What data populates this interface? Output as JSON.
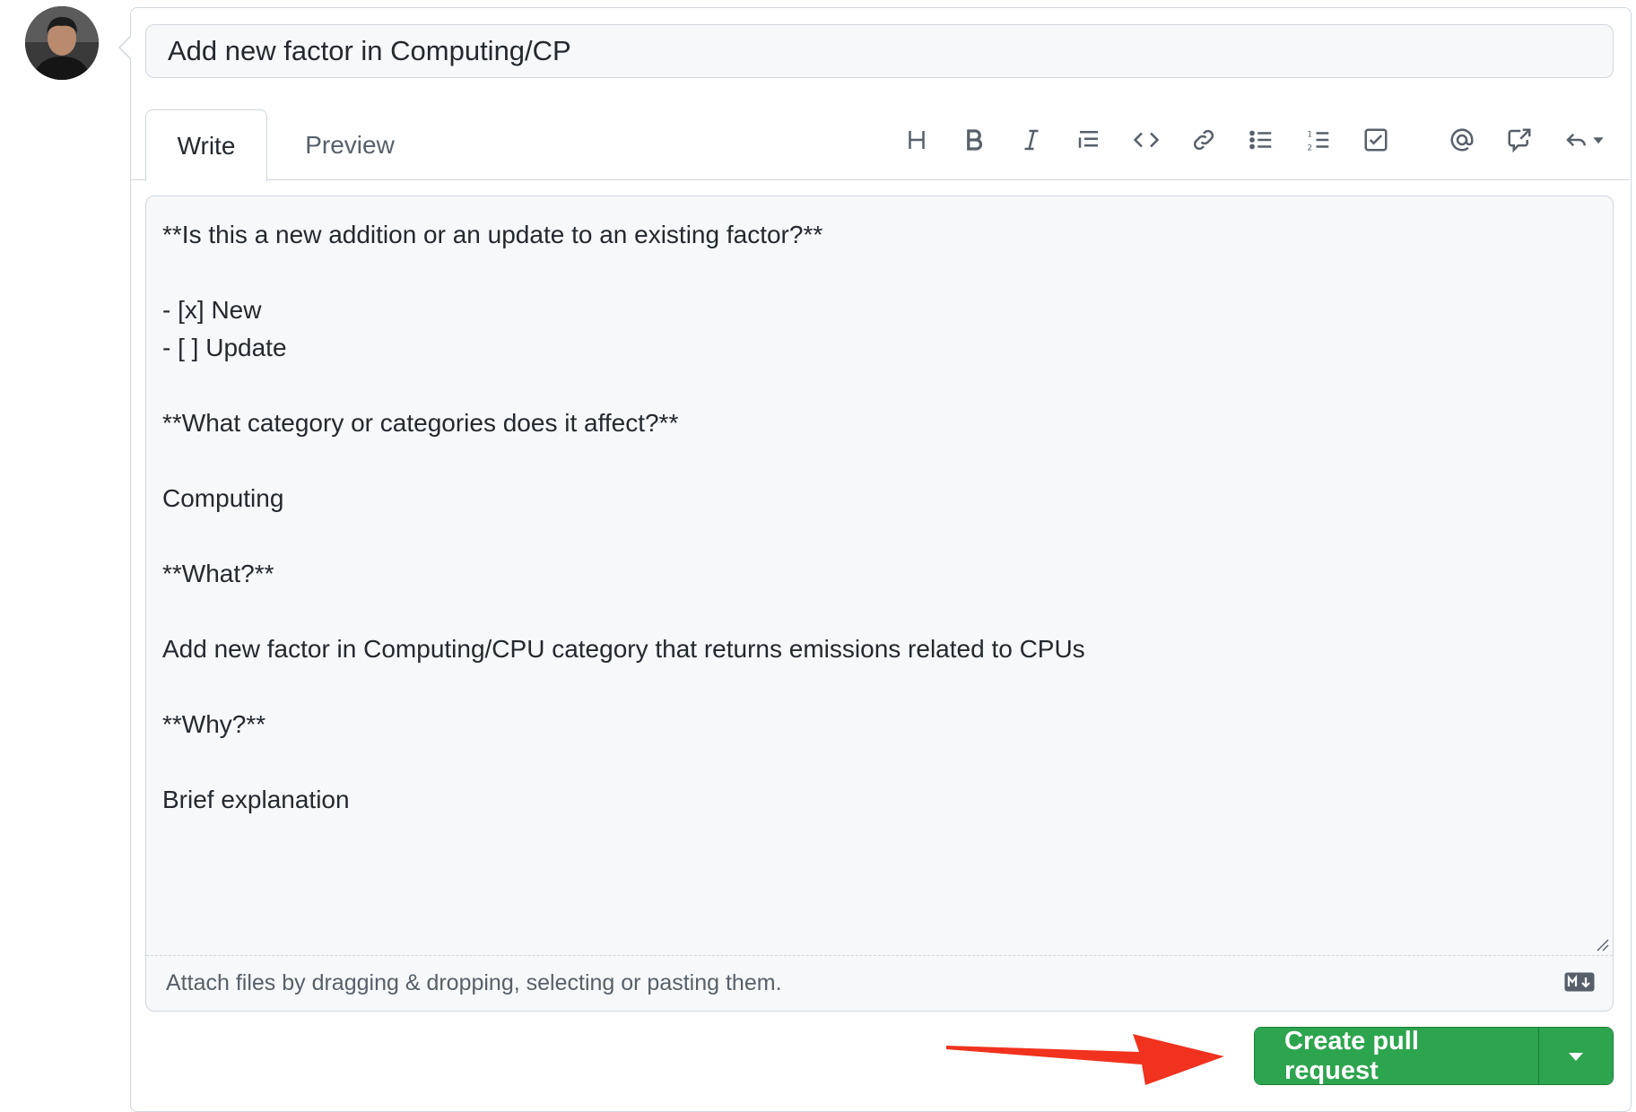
{
  "title_input": {
    "value": "Add new factor in Computing/CP"
  },
  "tabs": [
    {
      "label": "Write",
      "active": true
    },
    {
      "label": "Preview",
      "active": false
    }
  ],
  "toolbar": {
    "icons": [
      "heading-icon",
      "bold-icon",
      "italic-icon",
      "quote-icon",
      "code-icon",
      "link-icon",
      "unordered-list-icon",
      "ordered-list-icon",
      "task-list-icon",
      "mention-icon",
      "cross-reference-icon",
      "reply-icon"
    ]
  },
  "editor": {
    "body": "**Is this a new addition or an update to an existing factor?**\n\n- [x] New\n- [ ] Update\n\n**What category or categories does it affect?**\n\nComputing\n\n**What?**\n\nAdd new factor in Computing/CPU category that returns emissions related to CPUs\n\n**Why?**\n\nBrief explanation",
    "attach_hint": "Attach files by dragging & dropping, selecting or pasting them."
  },
  "actions": {
    "create_label": "Create pull request"
  },
  "colors": {
    "primary_button": "#2da44e",
    "annotation_arrow": "#f0321e",
    "editor_background": "#f6f8fa",
    "border": "#d0d7de"
  }
}
